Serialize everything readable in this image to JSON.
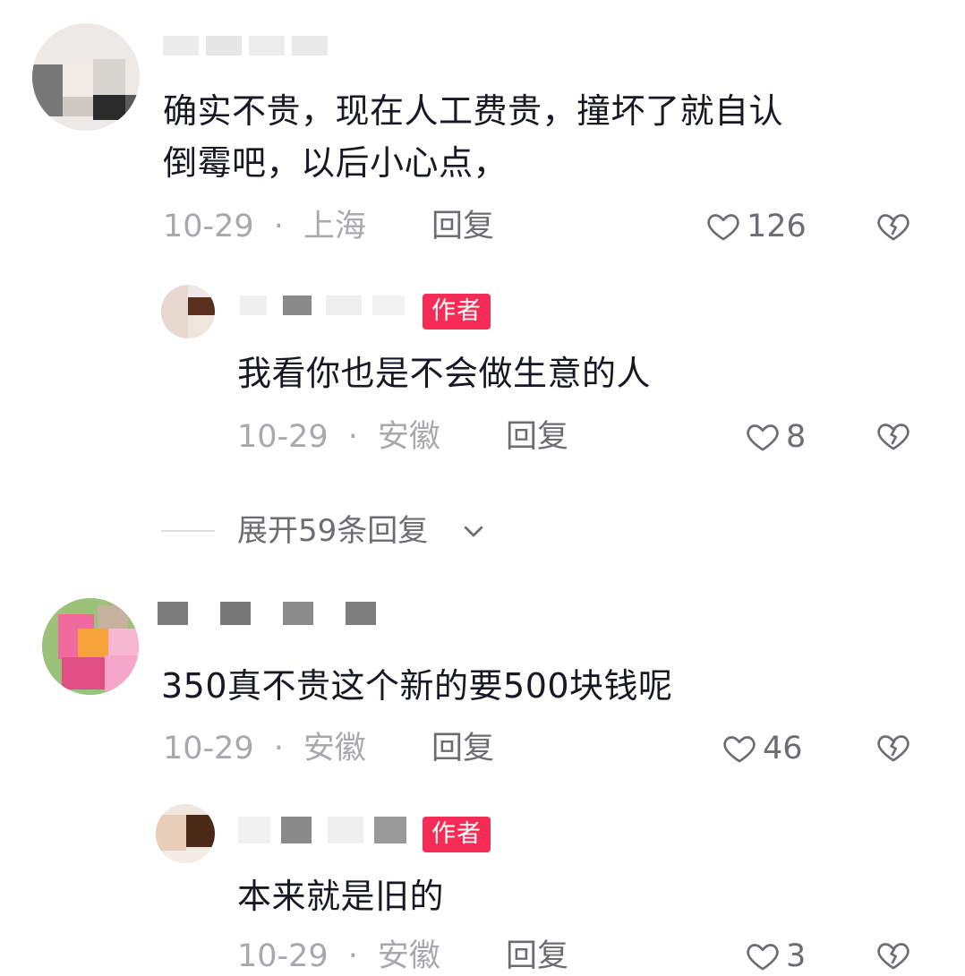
{
  "colors": {
    "text": "#161823",
    "meta": "#a8a9ad",
    "action": "#6c6d72",
    "author_badge": "#f52c56"
  },
  "comments": [
    {
      "content_lines": [
        "确实不贵，现在人工费贵，撞坏了就自认",
        "倒霉吧，以后小心点，"
      ],
      "date": "10-29",
      "location": "上海",
      "reply_label": "回复",
      "likes": "126",
      "reply": {
        "badge": "作者",
        "content": "我看你也是不会做生意的人",
        "date": "10-29",
        "location": "安徽",
        "reply_label": "回复",
        "likes": "8"
      },
      "expand_label": "展开59条回复"
    },
    {
      "content_lines": [
        "350真不贵这个新的要500块钱呢"
      ],
      "date": "10-29",
      "location": "安徽",
      "reply_label": "回复",
      "likes": "46",
      "reply": {
        "badge": "作者",
        "content": "本来就是旧的",
        "date": "10-29",
        "location": "安徽",
        "reply_label": "回复",
        "likes": "3"
      }
    }
  ],
  "icons": {
    "like": "heart-outline-icon",
    "dislike": "broken-heart-icon",
    "expand": "chevron-down-icon"
  }
}
